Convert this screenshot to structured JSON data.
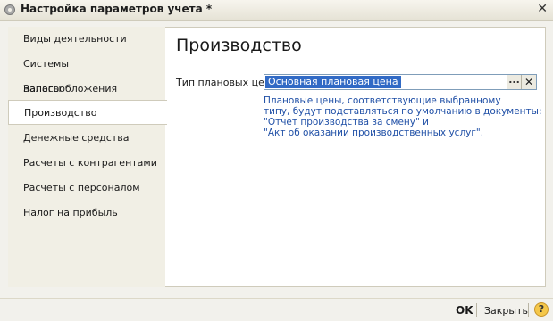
{
  "window": {
    "title": "Настройка параметров учета *",
    "close_glyph": "✕"
  },
  "nav": {
    "items": [
      {
        "label": "Виды деятельности",
        "active": false
      },
      {
        "label": "Системы налогообложения",
        "active": false
      },
      {
        "label": "Запасы",
        "active": false
      },
      {
        "label": "Производство",
        "active": true
      },
      {
        "label": "Денежные средства",
        "active": false
      },
      {
        "label": "Расчеты с контрагентами",
        "active": false
      },
      {
        "label": "Расчеты с персоналом",
        "active": false
      },
      {
        "label": "Налог на прибыль",
        "active": false
      }
    ]
  },
  "main": {
    "title": "Производство",
    "planned_price_label": "Тип плановых цен:",
    "planned_price_value": "Основная плановая цена",
    "select_button": "...",
    "clear_button": "✕",
    "hint_lines": [
      "Плановые цены, соответствующие выбранному",
      "типу, будут подставляться по умолчанию в документы:",
      "\"Отчет производства за смену\" и",
      "\"Акт об оказании производственных услуг\"."
    ]
  },
  "footer": {
    "ok_label": "OK",
    "close_label": "Закрыть",
    "help_glyph": "?"
  },
  "colors": {
    "selection": "#316ac5",
    "hint_text": "#1f4fa6",
    "background": "#f2f1ec"
  }
}
